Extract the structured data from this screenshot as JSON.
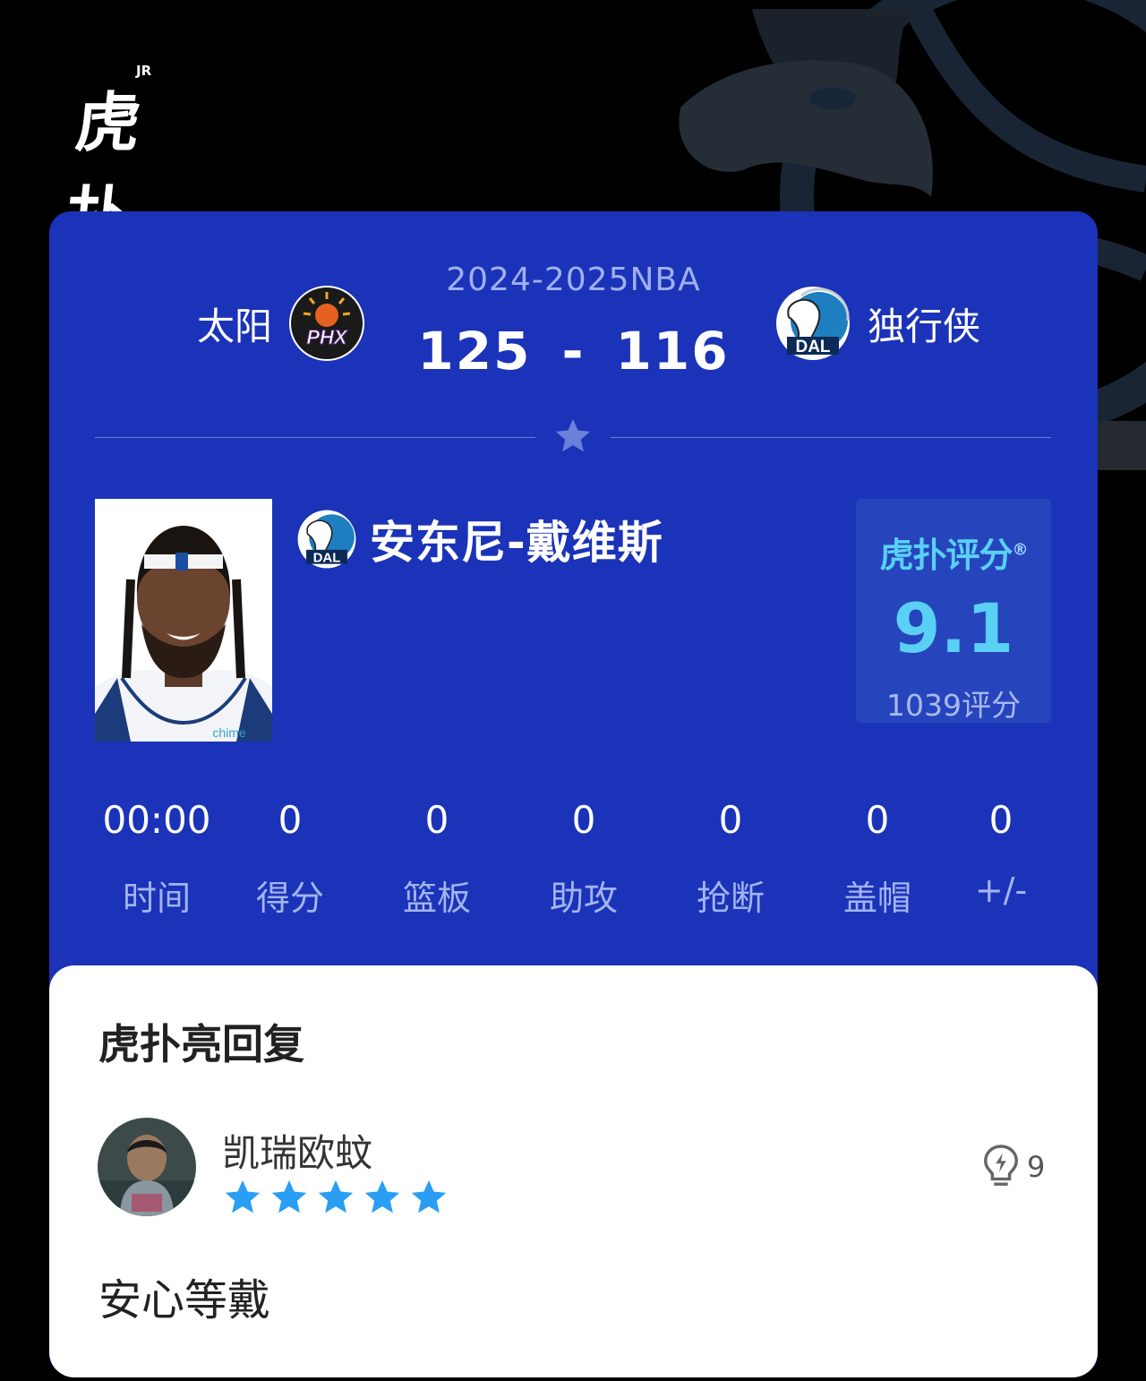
{
  "app": {
    "logo_text": "虎扑",
    "logo_sup": "JR"
  },
  "game": {
    "season": "2024-2025NBA",
    "home_team": {
      "name": "太阳",
      "logo_text": "PHX",
      "logo_icon": "suns-logo-icon"
    },
    "away_team": {
      "name": "独行侠",
      "logo_text": "DAL",
      "logo_icon": "mavericks-logo-icon"
    },
    "home_score": "125",
    "separator": "-",
    "away_score": "116"
  },
  "player": {
    "name": "安东尼-戴维斯",
    "team_logo_text": "DAL",
    "photo_icon": "player-photo",
    "jersey_text": "chime"
  },
  "rating": {
    "brand": "虎扑评分",
    "registered": "®",
    "value": "9.1",
    "count_label": "1039评分"
  },
  "stats": [
    {
      "value": "00:00",
      "label": "时间"
    },
    {
      "value": "0",
      "label": "得分"
    },
    {
      "value": "0",
      "label": "篮板"
    },
    {
      "value": "0",
      "label": "助攻"
    },
    {
      "value": "0",
      "label": "抢断"
    },
    {
      "value": "0",
      "label": "盖帽"
    },
    {
      "value": "0",
      "label": "+/-"
    }
  ],
  "reply": {
    "title": "虎扑亮回复",
    "username": "凯瑞欧蚊",
    "stars": 5,
    "likes": "9",
    "comment": "安心等戴"
  },
  "colors": {
    "card_bg": "#1b33b8",
    "rating_accent": "#5ad0f5",
    "star_blue": "#2a9df4",
    "label_muted": "#a3b4ee"
  }
}
